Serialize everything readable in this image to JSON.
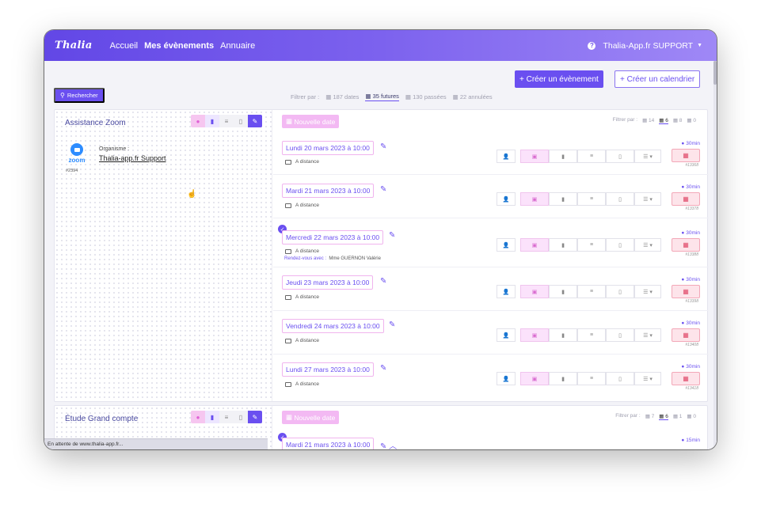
{
  "nav": {
    "logo": "Thalia",
    "links": [
      "Accueil",
      "Mes évènements",
      "Annuaire"
    ],
    "help_icon": "question-circle-icon",
    "account": "Thalia-App.fr SUPPORT"
  },
  "toolbar": {
    "create_event": "+ Créer un évènement",
    "create_calendar": "+ Créer un calendrier",
    "search": "Rechercher"
  },
  "filter": {
    "label": "Filtrer par :",
    "all": "187 dates",
    "future": "35 futures",
    "past": "130 passées",
    "cancelled": "22 annulées"
  },
  "cards": [
    {
      "title": "Assistance Zoom",
      "logo_word": "zoom",
      "org_label": "Organisme :",
      "org_name": "Thalia-app.fr Support",
      "id": "#2394",
      "new_date": "Nouvelle date",
      "filter": {
        "label": "Filtrer par :",
        "all": "14",
        "future": "6",
        "past": "8",
        "cancelled": "0"
      },
      "rows": [
        {
          "date": "Lundi 20 mars 2023 à 10:00",
          "location": "A distance",
          "duration": "30min",
          "id": "#13368"
        },
        {
          "date": "Mardi 21 mars 2023 à 10:00",
          "location": "A distance",
          "duration": "30min",
          "id": "#13378"
        },
        {
          "date": "Mercredi 22 mars 2023 à 10:00",
          "location": "A distance",
          "rdv_label": "Rendez-vous avec :",
          "rdv_name": "Mme GUERNON Valérie",
          "duration": "30min",
          "id": "#13388"
        },
        {
          "date": "Jeudi 23 mars 2023 à 10:00",
          "location": "A distance",
          "duration": "30min",
          "id": "#13398"
        },
        {
          "date": "Vendredi 24 mars 2023 à 10:00",
          "location": "A distance",
          "duration": "30min",
          "id": "#13408"
        },
        {
          "date": "Lundi 27 mars 2023 à 10:00",
          "location": "A distance",
          "duration": "30min",
          "id": "#13418"
        }
      ]
    },
    {
      "title": "Étude Grand compte",
      "new_date": "Nouvelle date",
      "filter": {
        "label": "Filtrer par :",
        "all": "7",
        "future": "6",
        "past": "1",
        "cancelled": "0"
      },
      "rows": [
        {
          "date": "Mardi 21 mars 2023 à 10:00",
          "duration": "15min"
        }
      ]
    }
  ],
  "status_bar": "En attente de www.thalia-app.fr...",
  "colors": {
    "primary": "#6a4ff0",
    "pink": "#f3b9f3",
    "danger": "#e04a6a"
  }
}
